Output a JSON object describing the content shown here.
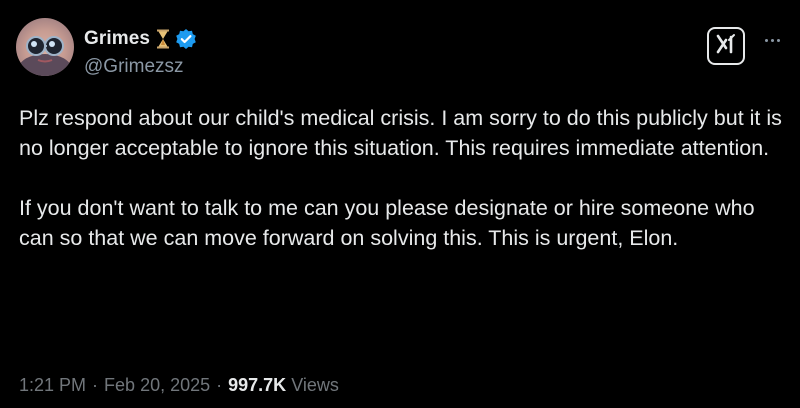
{
  "author": {
    "display_name": "Grimes",
    "handle": "@Grimezsz",
    "badge_icon": "hourglass-icon",
    "verified_icon": "verified-badge-icon",
    "verified_color": "#1d9bf0"
  },
  "post": {
    "paragraphs": [
      "Plz respond about our child's medical crisis.  I am sorry to do this publicly but it is no longer acceptable to ignore this situation.  This requires immediate attention.",
      "If you don't want to talk to me can you please designate or hire someone who can so that we can move forward on solving this. This is urgent, Elon."
    ]
  },
  "meta": {
    "time": "1:21 PM",
    "separator": "·",
    "date": "Feb 20, 2025",
    "views_count": "997.7K",
    "views_label": "Views"
  },
  "actions": {
    "grok_icon": "grok-icon",
    "more_icon": "more-options-icon"
  },
  "colors": {
    "background": "#000000",
    "text": "#e7e9ea",
    "secondary_text": "#71767b",
    "accent": "#1d9bf0"
  }
}
